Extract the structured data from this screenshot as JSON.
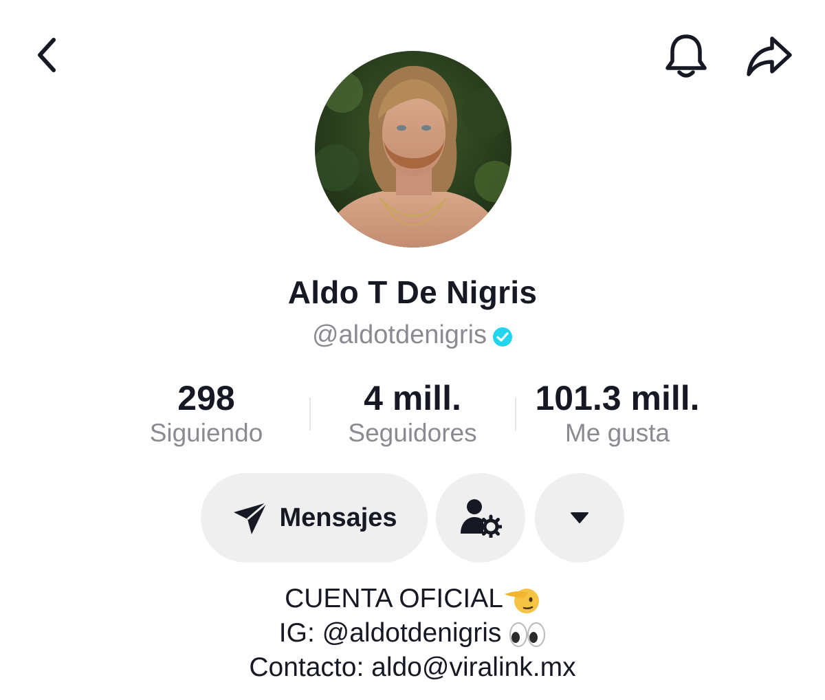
{
  "profile": {
    "name": "Aldo T De Nigris",
    "handle": "@aldotdenigris",
    "verified": true
  },
  "stats": [
    {
      "value": "298",
      "label": "Siguiendo"
    },
    {
      "value": "4 mill.",
      "label": "Seguidores"
    },
    {
      "value": "101.3 mill.",
      "label": "Me gusta"
    }
  ],
  "actions": {
    "message_label": "Mensajes"
  },
  "bio": {
    "line1": "CUENTA OFICIAL",
    "line2": "IG: @aldotdenigris ",
    "line3": "Contacto: aldo@viralink.mx"
  },
  "icons": {
    "back": "chevron-left-icon",
    "bell": "bell-icon",
    "share": "share-arrow-icon",
    "send": "send-icon",
    "friends": "person-gear-icon",
    "more": "triangle-down-icon",
    "salute": "saluting-face-emoji",
    "eyes": "eyes-emoji"
  },
  "colors": {
    "verified": "#20D5EC",
    "text": "#161823",
    "muted": "#8A8B91",
    "pill": "#EFEFEF"
  }
}
